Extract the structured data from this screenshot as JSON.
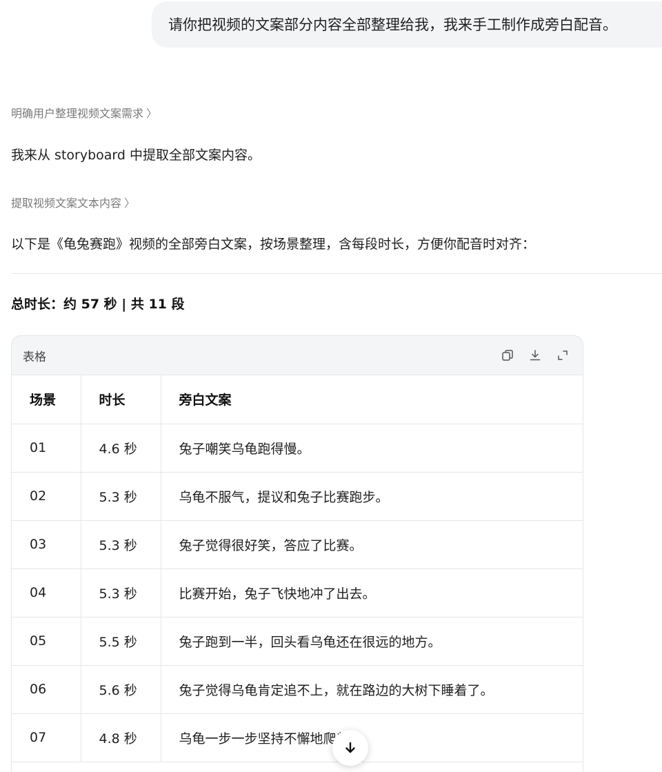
{
  "user_message": "请你把视频的文案部分内容全部整理给我，我来手工制作成旁白配音。",
  "steps": [
    {
      "label": "明确用户整理视频文案需求",
      "chevron": "〉"
    },
    {
      "label": "提取视频文案文本内容",
      "chevron": "〉"
    }
  ],
  "paragraphs": [
    "我来从 storyboard 中提取全部文案内容。",
    "以下是《龟兔赛跑》视频的全部旁白文案，按场景整理，含每段时长，方便你配音时对齐："
  ],
  "summary": "总时长：约 57 秒 | 共 11 段",
  "table_card": {
    "title": "表格",
    "tools": [
      "copy-icon",
      "download-icon",
      "expand-icon"
    ]
  },
  "table": {
    "headers": [
      "场景",
      "时长",
      "旁白文案"
    ],
    "rows": [
      [
        "01",
        "4.6 秒",
        "兔子嘲笑乌龟跑得慢。"
      ],
      [
        "02",
        "5.3 秒",
        "乌龟不服气，提议和兔子比赛跑步。"
      ],
      [
        "03",
        "5.3 秒",
        "兔子觉得很好笑，答应了比赛。"
      ],
      [
        "04",
        "5.3 秒",
        "比赛开始，兔子飞快地冲了出去。"
      ],
      [
        "05",
        "5.5 秒",
        "兔子跑到一半，回头看乌龟还在很远的地方。"
      ],
      [
        "06",
        "5.6 秒",
        "兔子觉得乌龟肯定追不上，就在路边的大树下睡着了。"
      ],
      [
        "07",
        "4.8 秒",
        "乌龟一步一步坚持不懈地爬着。"
      ]
    ]
  },
  "scroll_button_icon": "arrow-down-icon"
}
